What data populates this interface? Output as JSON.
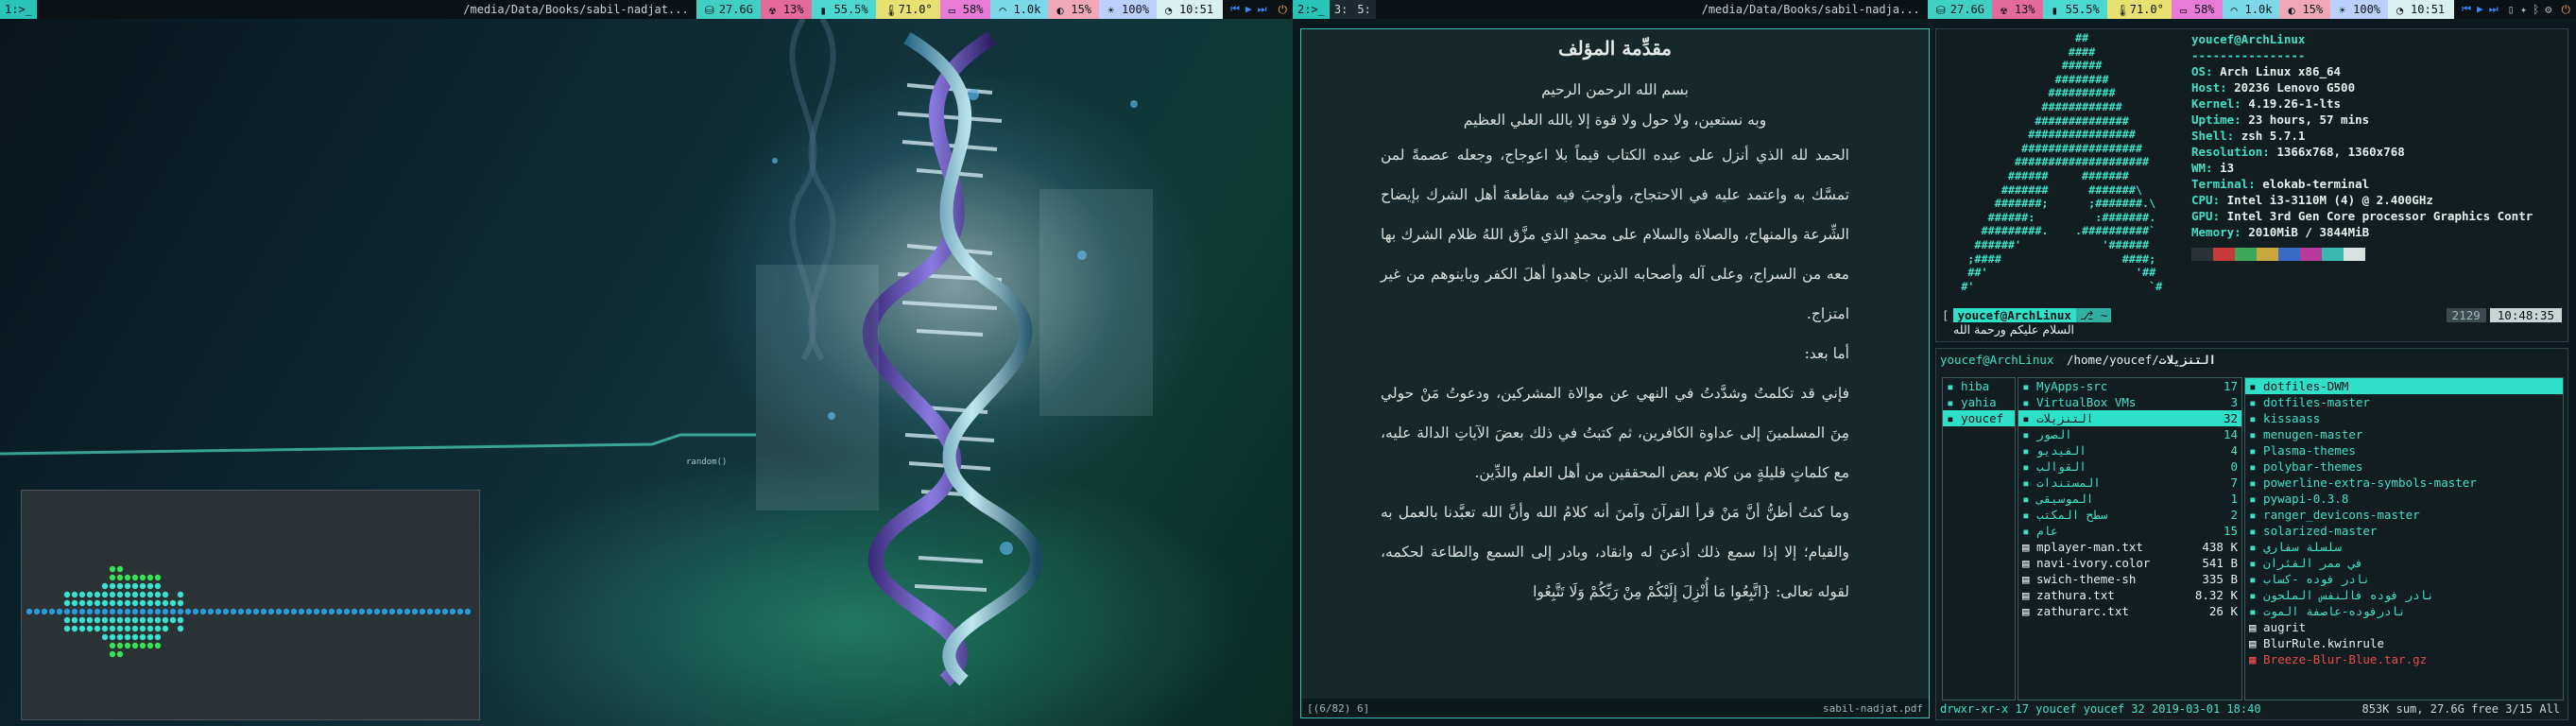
{
  "left_bar": {
    "workspace": "1:>_",
    "path": "/media/Data/Books/sabil-nadjat...",
    "disk": "27.6G",
    "cpu": "13%",
    "mem": "55.5%",
    "temp": "71.0°",
    "bat": "58%",
    "net": "1.0k",
    "vol": "15%",
    "bright": "100%",
    "clock": "10:51"
  },
  "right_bar": {
    "ws1": "2:>_",
    "ws2": "3:",
    "ws3": "5:",
    "path": "/media/Data/Books/sabil-nadja...",
    "disk": "27.6G",
    "cpu": "13%",
    "mem": "55.5%",
    "temp": "71.0°",
    "bat": "58%",
    "net": "1.0k",
    "vol": "15%",
    "bright": "100%",
    "clock": "10:51"
  },
  "wallpaper": {
    "label": "random()"
  },
  "pdf": {
    "title": "مقدِّمة المؤلف",
    "p1": "بسم الله الرحمن الرحيم",
    "p2": "وبه نستعين، ولا حول ولا قوة إلا بالله العلي العظيم",
    "p3": "الحمد لله الذي أنزل على عبده الكتاب قيماً بلا اعوجاج، وجعله عصمةً لمن تمسَّك به واعتمد عليه في الاحتجاج، وأوجبَ فيه مقاطعةَ أهل الشرك بإيضاح الشِّرعة والمنهاج، والصلاة والسلام على محمدٍ الذي مزَّق اللهُ ظلام الشرك بها معه من السراج، وعلى آله وأصحابه الذين جاهدوا أهلَ الكفر وباينوهم من غير امتزاج.",
    "p4": "أما بعد:",
    "p5": "فإني قد تكلمتُ وشدَّدتُ في النهي عن موالاة المشركين، ودعوتُ مَنْ حولي مِنَ المسلمينَ إلى عداوة الكافرين، ثم كتبتُ في ذلك بعضَ الآياتِ الدالة عليه، مع كلماتٍ قليلةٍ من كلام بعض المحققين من أهل العلم والدِّين.",
    "p6": "وما كنتُ أظنُّ أنَّ مَنْ قرأ القرآنَ وآمنَ أنه كلامُ الله وأنَّ الله تعبَّدنا بالعمل به والقيام؛ إلا إذا سمع ذلك أذعنَ له وانقاد، وبادر إلى السمع والطاعة لحكمه، لقوله تعالى: {اتَّبِعُوا مَا أُنْزِلَ إِلَيْكُمْ مِنْ رَبِّكُمْ وَلَا تَتَّبِعُوا",
    "status_left": "[(6/82) 6]",
    "status_right": "sabil-nadjat.pdf"
  },
  "neofetch": {
    "logo": [
      "                   ##",
      "                  ####",
      "                 ######",
      "                ########",
      "               ##########",
      "              ############",
      "             ##############",
      "            ################",
      "           ##################",
      "          ####################",
      "         ######     #######",
      "        #######      #######\\",
      "       #######;      ;#######.\\",
      "      ######:         :#######.",
      "     #########.    .##########`",
      "    ######'            '######",
      "   ;####                  ####;",
      "   ##'                      '##",
      "  #'                          `#"
    ],
    "userhost": "youcef@ArchLinux",
    "sep": "----------------",
    "info": [
      [
        "OS",
        "Arch Linux x86_64"
      ],
      [
        "Host",
        "20236 Lenovo G500"
      ],
      [
        "Kernel",
        "4.19.26-1-lts"
      ],
      [
        "Uptime",
        "23 hours, 57 mins"
      ],
      [
        "Shell",
        "zsh 5.7.1"
      ],
      [
        "Resolution",
        "1366x768, 1360x768"
      ],
      [
        "WM",
        "i3"
      ],
      [
        "Terminal",
        "elokab-terminal"
      ],
      [
        "CPU",
        "Intel i3-3110M (4) @ 2.400GHz"
      ],
      [
        "GPU",
        "Intel 3rd Gen Core processor Graphics Contr"
      ],
      [
        "Memory",
        "2010MiB / 3844MiB"
      ]
    ],
    "palette": [
      "#2a3236",
      "#c83a3a",
      "#3fa858",
      "#c8a83a",
      "#3a6ac8",
      "#b83a9a",
      "#3ab8b0",
      "#d8e0e0"
    ],
    "prompt_user": "youcef@ArchLinux",
    "prompt_line": "السلام عليكم ورحمة الله",
    "hist": "2129",
    "time": "10:48:35"
  },
  "ranger": {
    "header_user": "youcef@ArchLinux",
    "header_path": "/home/youcef/",
    "header_dir": "التنزيلات",
    "col1": [
      "hiba",
      "yahia",
      "youcef"
    ],
    "col2": [
      [
        "MyApps-src",
        "17"
      ],
      [
        "VirtualBox VMs",
        "3"
      ],
      [
        "التنزيلات",
        "32"
      ],
      [
        "الصور",
        "14"
      ],
      [
        "الفيديو",
        "4"
      ],
      [
        "القوالب",
        "0"
      ],
      [
        "المستندات",
        "7"
      ],
      [
        "الموسيقى",
        "1"
      ],
      [
        "سطح المكتب",
        "2"
      ],
      [
        "عام",
        "15"
      ],
      [
        "mplayer-man.txt",
        "438 K"
      ],
      [
        "navi-ivory.color",
        "541 B"
      ],
      [
        "swich-theme-sh",
        "335 B"
      ],
      [
        "zathura.txt",
        "8.32 K"
      ],
      [
        "zathurarc.txt",
        "26 K"
      ]
    ],
    "col3": [
      "dotfiles-DWM",
      "dotfiles-master",
      "kissaass",
      "menugen-master",
      "Plasma-themes",
      "polybar-themes",
      "powerline-extra-symbols-master",
      "pywapi-0.3.8",
      "ranger_devicons-master",
      "solarized-master",
      "سلسلة سفاري",
      "في ممر الفئران",
      "نادر فوده -كساب",
      "نادر فوده فالنفس الملحون",
      "نادرفوده-عاصفة الموت",
      "augrit",
      "BlurRule.kwinrule",
      "Breeze-Blur-Blue.tar.gz"
    ],
    "status_left": "drwxr-xr-x 17 youcef youcef 32 2019-03-01 18:40",
    "status_right": "853K sum, 27.6G free  3/15  All"
  }
}
